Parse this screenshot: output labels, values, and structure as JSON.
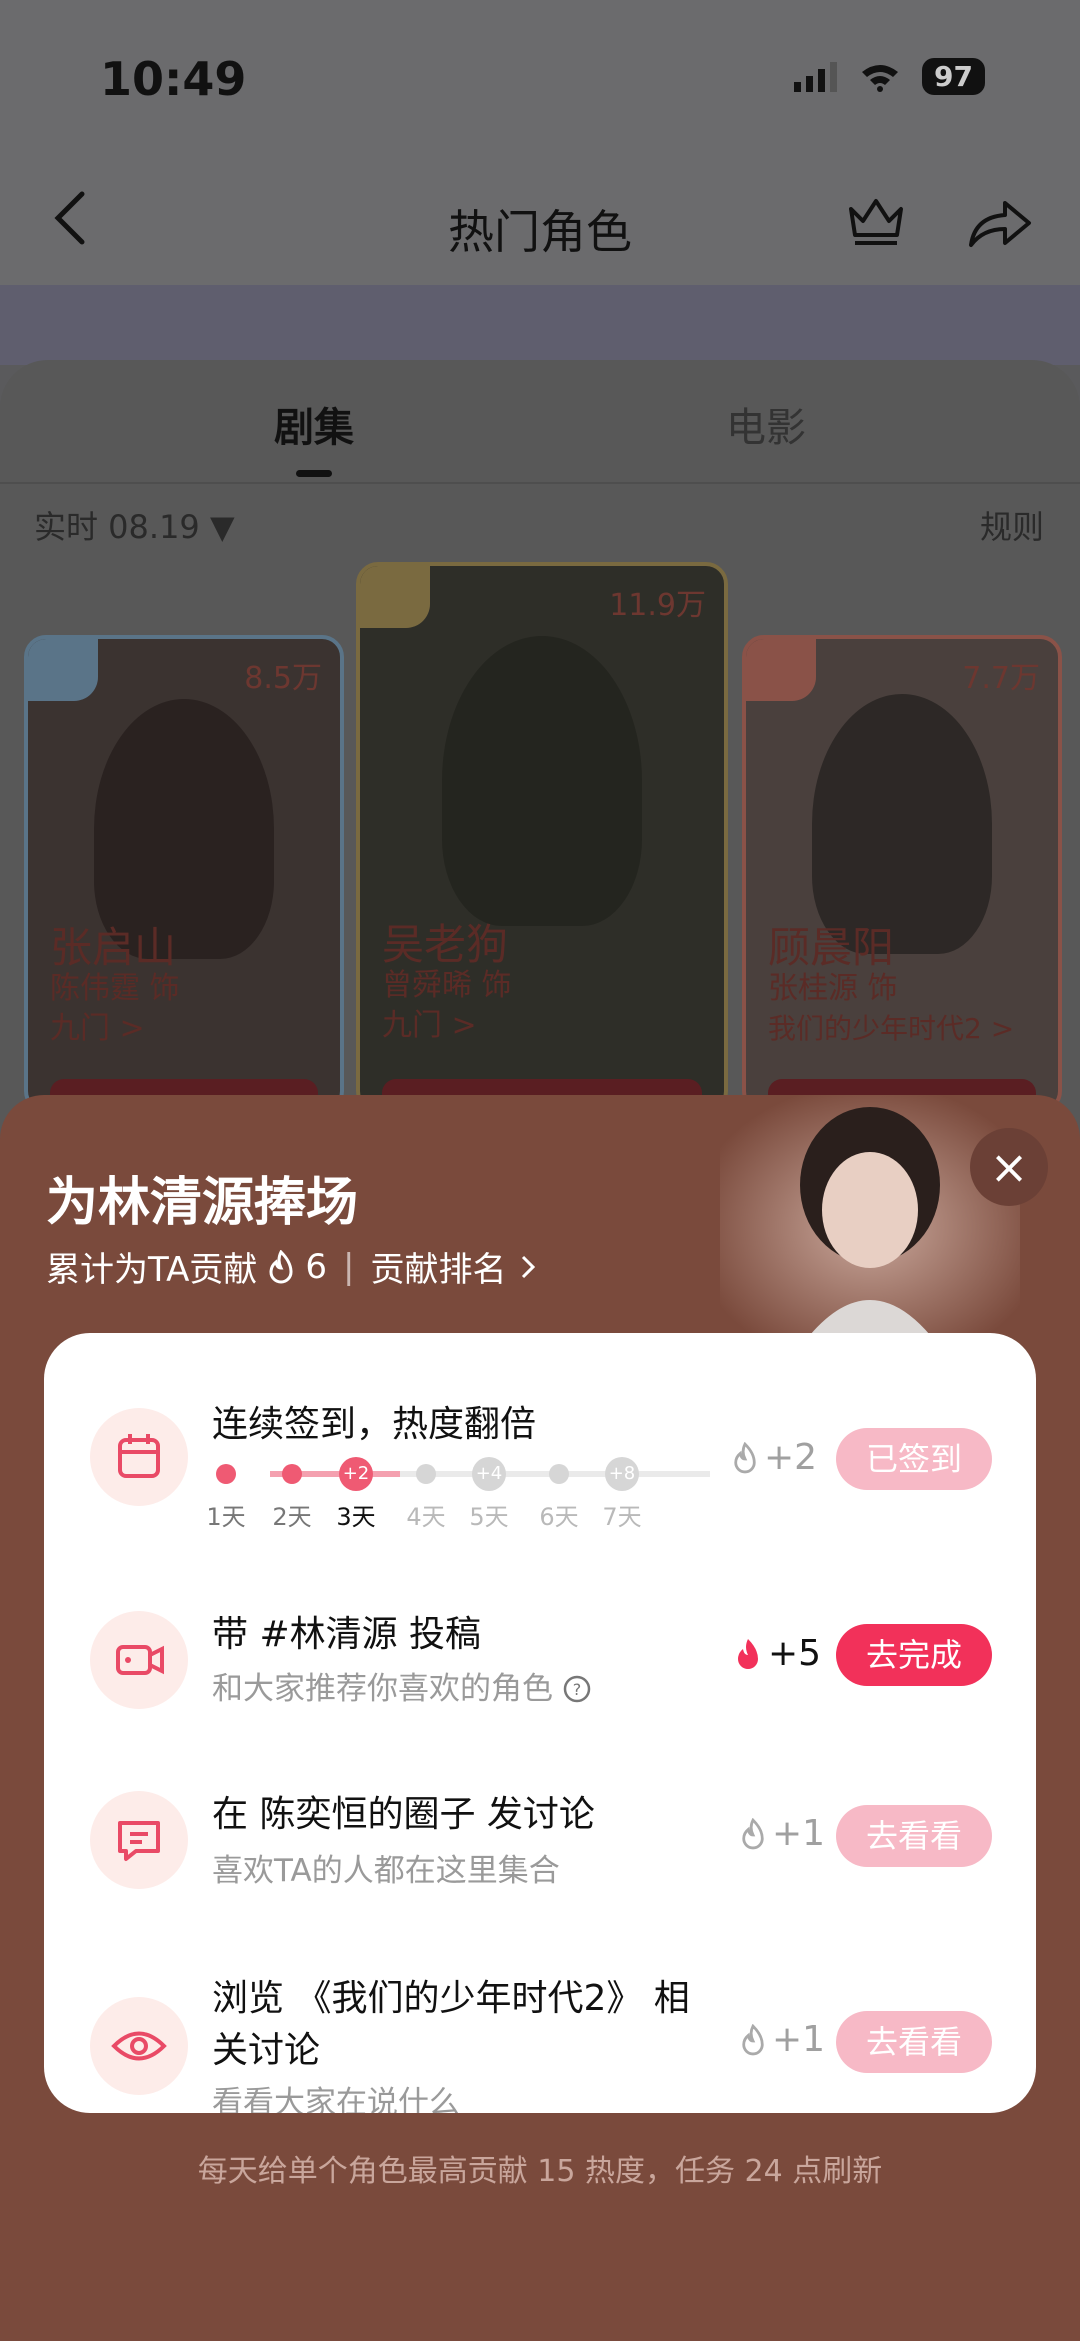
{
  "status": {
    "time": "10:49",
    "battery": "97"
  },
  "nav": {
    "title": "热门角色"
  },
  "tabs": [
    {
      "label": "剧集"
    },
    {
      "label": "电影"
    }
  ],
  "filter": {
    "realtime": "实时 08.19 ▼",
    "rules": "规则"
  },
  "cards": [
    {
      "heat": "8.5万",
      "name": "张启山",
      "actor": "陈伟霆 饰",
      "show": "九门 >"
    },
    {
      "heat": "11.9万",
      "name": "吴老狗",
      "actor": "曾舜晞 饰",
      "show": "九门 >"
    },
    {
      "heat": "7.7万",
      "name": "顾晨阳",
      "actor": "张桂源 饰",
      "show": "我们的少年时代2 >"
    }
  ],
  "sheet": {
    "title": "为林清源捧场",
    "contribution_label": "累计为TA贡献",
    "contribution_value": "6",
    "rank_label": "贡献排名",
    "close_icon": "×",
    "footer": "每天给单个角色最高贡献 15 热度，任务 24 点刷新"
  },
  "tasks": [
    {
      "title": "连续签到，热度翻倍",
      "points": "+2",
      "button": "已签到",
      "days": [
        {
          "label": "1天",
          "badge": ""
        },
        {
          "label": "2天",
          "badge": ""
        },
        {
          "label": "3天",
          "badge": "+2"
        },
        {
          "label": "4天",
          "badge": ""
        },
        {
          "label": "5天",
          "badge": "+4"
        },
        {
          "label": "6天",
          "badge": ""
        },
        {
          "label": "7天",
          "badge": "+8"
        }
      ]
    },
    {
      "title": "带 #林清源 投稿",
      "desc": "和大家推荐你喜欢的角色",
      "points": "+5",
      "button": "去完成"
    },
    {
      "title": "在 陈奕恒的圈子 发讨论",
      "desc": "喜欢TA的人都在这里集合",
      "points": "+1",
      "button": "去看看"
    },
    {
      "title_line1": "浏览 《我们的少年时代2》 相",
      "title_line2": "关讨论",
      "desc": "看看大家在说什么",
      "points": "+1",
      "button": "去看看"
    }
  ],
  "colors": {
    "accent": "#f2315a",
    "sheet_bg": "#7a4a3c",
    "button_disabled": "#f7b9c6"
  }
}
